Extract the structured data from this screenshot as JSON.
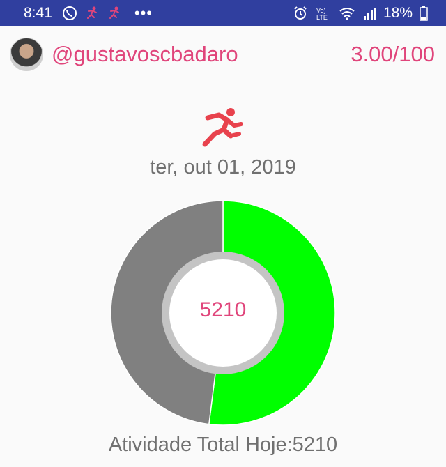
{
  "status_bar": {
    "time": "8:41",
    "left_icons": [
      "whatsapp-icon",
      "runner-notification-icon",
      "runner-notification-icon"
    ],
    "more": "•••",
    "right_icons": [
      "alarm-icon",
      "volte-icon",
      "wifi-icon",
      "signal-icon",
      "battery-icon"
    ],
    "battery_text": "18%"
  },
  "header": {
    "username": "@gustavoscbadaro",
    "score": "3.00/100"
  },
  "main": {
    "date": "ter, out 01, 2019",
    "center_value": "5210",
    "total_label": "Atividade Total Hoje:5210"
  },
  "colors": {
    "status_bar": "#303f9f",
    "accent": "#e0457b",
    "donut_active": "#00ff00",
    "donut_remaining": "#808080",
    "text_secondary": "#707070"
  },
  "chart_data": {
    "type": "pie",
    "style": "donut",
    "slices": [
      {
        "label": "active",
        "value": 52,
        "color": "#00ff00"
      },
      {
        "label": "remaining",
        "value": 48,
        "color": "#808080"
      }
    ]
  }
}
